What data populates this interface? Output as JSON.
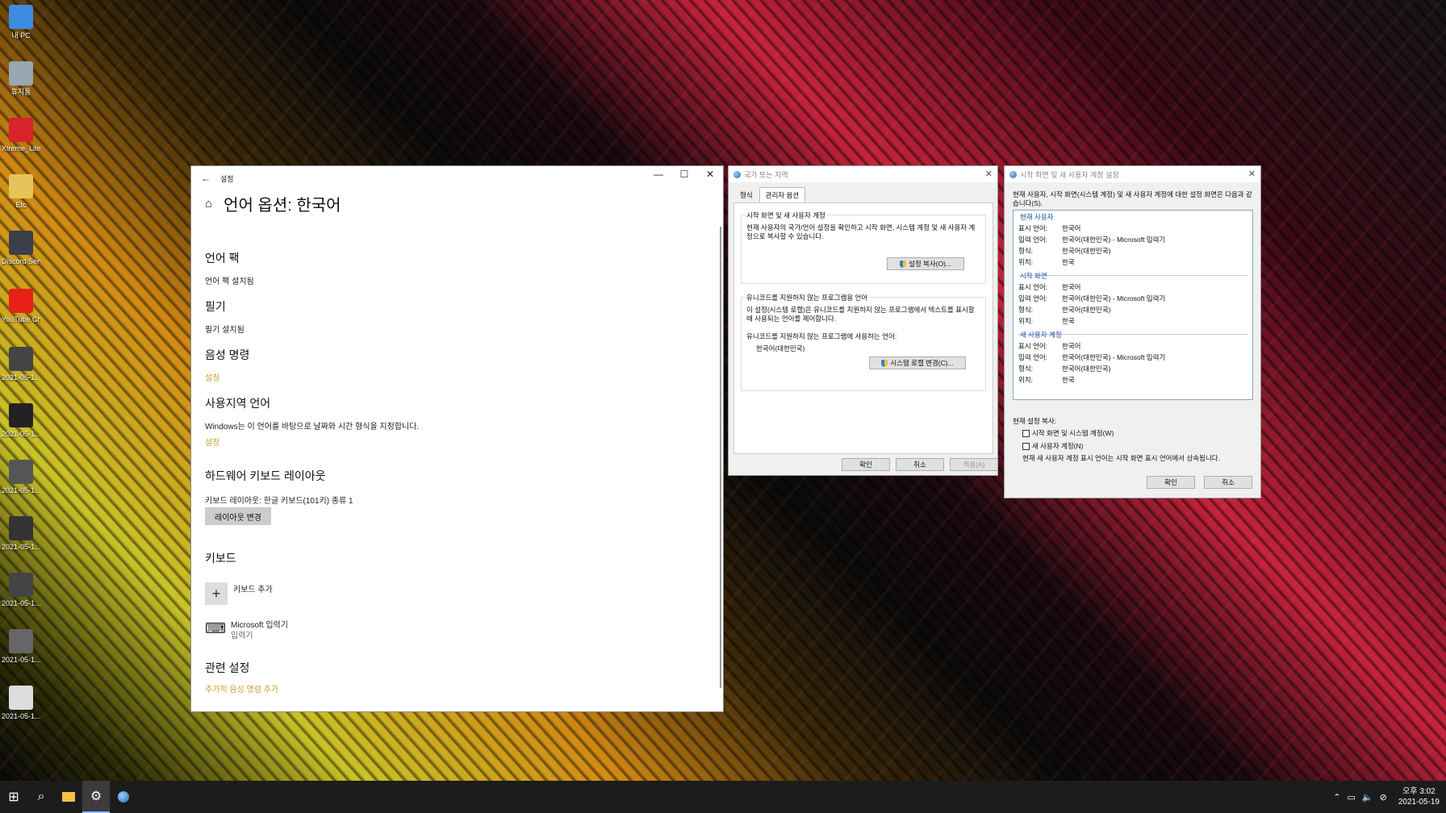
{
  "desktop": {
    "icons": [
      {
        "label": "내 PC",
        "color": "#3d8be0"
      },
      {
        "label": "휴지통",
        "color": "#9aa6b0"
      },
      {
        "label": "Xtreme_Lite...",
        "color": "#d8232a"
      },
      {
        "label": "Etc",
        "color": "#e8c35a"
      },
      {
        "label": "Discord Server",
        "color": "#3a3f4a"
      },
      {
        "label": "YouTube Channel",
        "color": "#e62117"
      },
      {
        "label": "2021-05-1...",
        "color": "#444"
      },
      {
        "label": "2021-05-1...",
        "color": "#222"
      },
      {
        "label": "2021-05-1...",
        "color": "#555"
      },
      {
        "label": "2021-05-1...",
        "color": "#333"
      },
      {
        "label": "2021-05-1...",
        "color": "#444"
      },
      {
        "label": "2021-05-1...",
        "color": "#666"
      },
      {
        "label": "2021-05-1...",
        "color": "#ddd"
      }
    ]
  },
  "settings": {
    "title": "설정",
    "page_title": "언어 옵션: 한국어",
    "language_pack": {
      "heading": "언어 팩",
      "status": "언어 팩 설치됨"
    },
    "handwriting": {
      "heading": "필기",
      "status": "필기 설치됨"
    },
    "voice": {
      "heading": "음성 명령",
      "link": "설정"
    },
    "regional": {
      "heading": "사용지역 언어",
      "text": "Windows는 이 언어를 바탕으로 날짜와 시간 형식을 지정합니다.",
      "link": "설정"
    },
    "hardware_keyboard": {
      "heading": "하드웨어 키보드 레이아웃",
      "text": "키보드 레이아웃:   한글 키보드(101키) 종류 1",
      "button": "레이아웃 변경"
    },
    "keyboards": {
      "heading": "키보드",
      "add": "키보드 추가",
      "item_name": "Microsoft 입력기",
      "item_type": "입력기"
    },
    "related": {
      "heading": "관련 설정",
      "link": "추가적 음성 명령 추가"
    }
  },
  "region_dialog": {
    "title": "국가 또는 지역",
    "tabs": [
      "형식",
      "관리자 옵션"
    ],
    "group1": {
      "title": "시작 화면 및 새 사용자 계정",
      "text": "현재 사용자의 국가/언어 설정을 확인하고 시작 화면, 시스템 계정 및 새 사용자 계정으로 복사할 수 있습니다.",
      "button": "설정 복사(O)..."
    },
    "group2": {
      "title": "유니코드를 지원하지 않는 프로그램용 언어",
      "text": "이 설정(시스템 로캘)은 유니코드를 지원하지 않는 프로그램에서 텍스트를 표시할 때 사용되는 언어를 제어합니다.",
      "current_label": "유니코드를 지원하지 않는 프로그램에 사용하는 언어:",
      "current_value": "한국어(대한민국)",
      "button": "시스템 로캘 변경(C)..."
    },
    "ok": "확인",
    "cancel": "취소",
    "apply": "적용(A)"
  },
  "welcome_dialog": {
    "title": "시작 화면 및 새 사용자 계정 설정",
    "intro": "현재 사용자, 시작 화면(시스템 계정) 및 새 사용자 계정에 대한 설정 화면은 다음과 같습니다(S).",
    "labels": {
      "display": "표시 언어:",
      "input": "입력 언어:",
      "format": "형식:",
      "location": "위치:"
    },
    "groups": [
      {
        "name": "현재 사용자",
        "display": "한국어",
        "input": "한국어(대한민국) - Microsoft 입력기",
        "format": "한국어(대한민국)",
        "location": "한국"
      },
      {
        "name": "시작 화면",
        "display": "한국어",
        "input": "한국어(대한민국) - Microsoft 입력기",
        "format": "한국어(대한민국)",
        "location": "한국"
      },
      {
        "name": "새 사용자 계정",
        "display": "한국어",
        "input": "한국어(대한민국) - Microsoft 입력기",
        "format": "한국어(대한민국)",
        "location": "한국"
      }
    ],
    "copy_label": "현재 설정 복사:",
    "check1": "시작 화면 및 시스템 계정(W)",
    "check2": "새 사용자 계정(N)",
    "note": "현재 새 사용자 계정 표시 언어는 시작 화면 표시 언어에서 상속됩니다.",
    "ok": "확인",
    "cancel": "취소"
  },
  "taskbar": {
    "time": "오후 3:02",
    "date": "2021-05-19"
  }
}
